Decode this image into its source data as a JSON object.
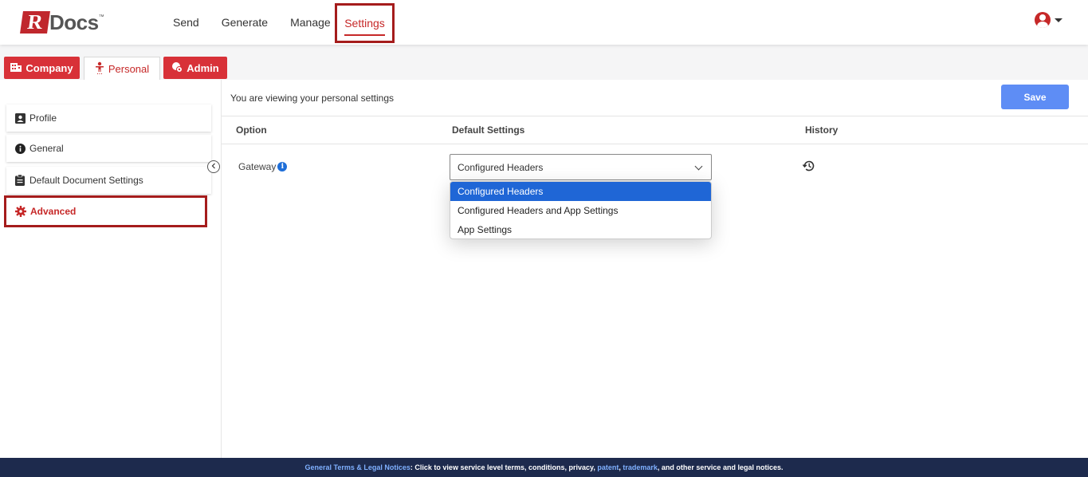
{
  "app": {
    "logo_letter": "R",
    "logo_text": "Docs",
    "logo_tm": "™"
  },
  "nav": {
    "items": [
      "Send",
      "Generate",
      "Manage",
      "Settings"
    ],
    "active": "Settings"
  },
  "tabs": {
    "company": "Company",
    "personal": "Personal",
    "admin": "Admin"
  },
  "sidebar": {
    "items": [
      {
        "label": "Profile",
        "icon": "profile-card-icon"
      },
      {
        "label": "General",
        "icon": "info-icon"
      },
      {
        "label": "Default Document Settings",
        "icon": "clipboard-icon"
      },
      {
        "label": "Advanced",
        "icon": "gear-icon"
      }
    ],
    "active": "Advanced"
  },
  "main": {
    "viewing_text": "You are viewing your personal settings",
    "save_label": "Save",
    "columns": [
      "Option",
      "Default Settings",
      "History"
    ],
    "rows": [
      {
        "option": "Gateway",
        "value": "Configured Headers"
      }
    ],
    "dropdown_options": [
      "Configured Headers",
      "Configured Headers and App Settings",
      "App Settings"
    ],
    "dropdown_selected": "Configured Headers"
  },
  "footer": {
    "link1": "General Terms & Legal Notices",
    "text1": ": Click to view service level terms, conditions, privacy, ",
    "link2": "patent",
    "sep": ", ",
    "link3": "trademark",
    "text2": ", and other service and legal notices."
  },
  "colors": {
    "brand_red": "#c62828",
    "tab_red": "#d83138",
    "save_blue": "#5e8df5",
    "selected_blue": "#1f66d6",
    "footer_navy": "#1d2a4d"
  }
}
